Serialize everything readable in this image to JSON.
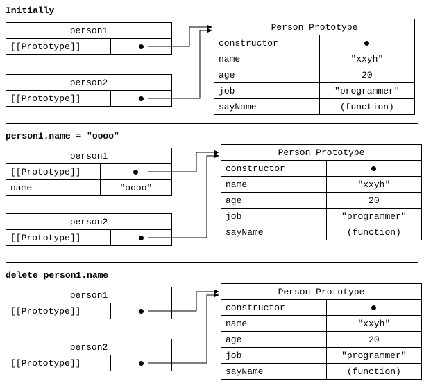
{
  "sections": [
    {
      "title": "Initially",
      "left": [
        {
          "name": "person1",
          "rows": [
            [
              "[[Prototype]]",
              "dot"
            ]
          ]
        },
        {
          "name": "person2",
          "rows": [
            [
              "[[Prototype]]",
              "dot"
            ]
          ]
        }
      ],
      "right": {
        "name": "Person Prototype",
        "rows": [
          [
            "constructor",
            "dot"
          ],
          [
            "name",
            "\"xxyh\""
          ],
          [
            "age",
            "20"
          ],
          [
            "job",
            "\"programmer\""
          ],
          [
            "sayName",
            "(function)"
          ]
        ]
      }
    },
    {
      "title": "person1.name = \"oooo\"",
      "left": [
        {
          "name": "person1",
          "rows": [
            [
              "[[Prototype]]",
              "dot"
            ],
            [
              "name",
              "\"oooo\""
            ]
          ]
        },
        {
          "name": "person2",
          "rows": [
            [
              "[[Prototype]]",
              "dot"
            ]
          ]
        }
      ],
      "right": {
        "name": "Person Prototype",
        "rows": [
          [
            "constructor",
            "dot"
          ],
          [
            "name",
            "\"xxyh\""
          ],
          [
            "age",
            "20"
          ],
          [
            "job",
            "\"programmer\""
          ],
          [
            "sayName",
            "(function)"
          ]
        ]
      }
    },
    {
      "title": "delete person1.name",
      "left": [
        {
          "name": "person1",
          "rows": [
            [
              "[[Prototype]]",
              "dot"
            ]
          ]
        },
        {
          "name": "person2",
          "rows": [
            [
              "[[Prototype]]",
              "dot"
            ]
          ]
        }
      ],
      "right": {
        "name": "Person Prototype",
        "rows": [
          [
            "constructor",
            "dot"
          ],
          [
            "name",
            "\"xxyh\""
          ],
          [
            "age",
            "20"
          ],
          [
            "job",
            "\"programmer\""
          ],
          [
            "sayName",
            "(function)"
          ]
        ]
      }
    }
  ]
}
